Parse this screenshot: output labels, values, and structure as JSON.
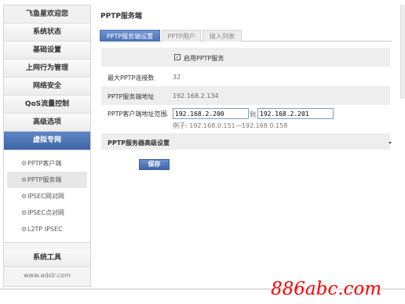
{
  "sidebar": {
    "items_top": [
      {
        "label": "飞鱼星欢迎您"
      },
      {
        "label": "系统状态"
      },
      {
        "label": "基础设置"
      },
      {
        "label": "上网行为管理"
      },
      {
        "label": "网络安全"
      },
      {
        "label": "QoS流量控制"
      },
      {
        "label": "高级选项"
      },
      {
        "label": "虚拟专网"
      }
    ],
    "sub_items": [
      {
        "label": "PPTP客户端"
      },
      {
        "label": "PPTP服务端"
      },
      {
        "label": "IPSEC网对网"
      },
      {
        "label": "IPSEC点对网"
      },
      {
        "label": "L2TP IPSEC"
      }
    ],
    "tools_label": "系统工具",
    "footer_url": "www.adslr.com"
  },
  "page": {
    "title": "PPTP服务端",
    "tabs": [
      {
        "label": "PPTP服务端设置"
      },
      {
        "label": "PPTP用户"
      },
      {
        "label": "拨入列表"
      }
    ]
  },
  "form": {
    "enable_label": "启用PPTP服务",
    "enable_checked": true,
    "max_conn_label": "最大PPTP连接数",
    "max_conn_value": "32",
    "server_addr_label": "PPTP服务端地址",
    "server_addr_value": "192.168.2.134",
    "client_range_label": "PPTP客户端地址范围.",
    "client_range_start": "192.168.2.200",
    "client_range_to": "到",
    "client_range_end": "192.168.2.201",
    "example": "例子:   192.168.0.151—192.168.0.158",
    "advanced_label": "PPTP服务器高级设置",
    "save_label": "保存"
  },
  "watermark": "886abc.com"
}
